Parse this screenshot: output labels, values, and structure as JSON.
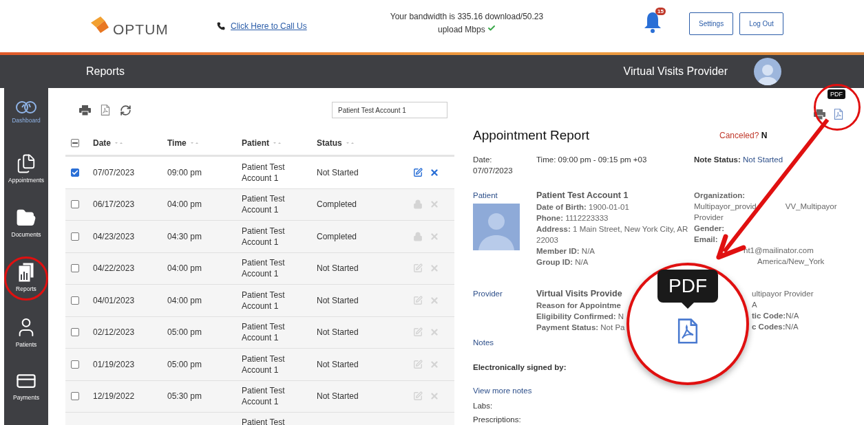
{
  "header": {
    "logo": "OPTUM",
    "call_link": "Click Here to Call Us",
    "bandwidth_line_1": "Your bandwidth is 335.16 download/50.23",
    "bandwidth_line_2": "upload Mbps",
    "bandwidth_ok": true,
    "notification_count": "15",
    "buttons": [
      "Settings",
      "Log Out"
    ]
  },
  "title_bar": {
    "title": "Reports",
    "user": "Virtual Visits Provider"
  },
  "sidebar": {
    "items": [
      {
        "kind": "dashboard",
        "label": "Dashboard",
        "selected": true,
        "circled": false
      },
      {
        "kind": "appointments",
        "label": "Appointments",
        "selected": false,
        "circled": false
      },
      {
        "kind": "documents",
        "label": "Documents",
        "selected": false,
        "circled": false
      },
      {
        "kind": "reports",
        "label": "Reports",
        "selected": false,
        "circled": true
      },
      {
        "kind": "patients",
        "label": "Patients",
        "selected": false,
        "circled": false
      },
      {
        "kind": "payments",
        "label": "Payments",
        "selected": false,
        "circled": false
      }
    ]
  },
  "search": {
    "value": "Patient Test Account 1"
  },
  "table": {
    "select_all_partial": true,
    "columns": [
      "Date",
      "Time",
      "Patient",
      "Status"
    ],
    "rows": [
      {
        "date": "07/07/2023",
        "time": "09:00 pm",
        "patient": "Patient Test Account 1",
        "status": "Not Started",
        "checked": true,
        "locked": false
      },
      {
        "date": "06/17/2023",
        "time": "04:00 pm",
        "patient": "Patient Test Account 1",
        "status": "Completed",
        "checked": false,
        "locked": true
      },
      {
        "date": "04/23/2023",
        "time": "04:30 pm",
        "patient": "Patient Test Account 1",
        "status": "Completed",
        "checked": false,
        "locked": true
      },
      {
        "date": "04/22/2023",
        "time": "04:00 pm",
        "patient": "Patient Test Account 1",
        "status": "Not Started",
        "checked": false,
        "locked": false
      },
      {
        "date": "04/01/2023",
        "time": "04:00 pm",
        "patient": "Patient Test Account 1",
        "status": "Not Started",
        "checked": false,
        "locked": false
      },
      {
        "date": "02/12/2023",
        "time": "05:00 pm",
        "patient": "Patient Test Account 1",
        "status": "Not Started",
        "checked": false,
        "locked": false
      },
      {
        "date": "01/19/2023",
        "time": "05:00 pm",
        "patient": "Patient Test Account 1",
        "status": "Not Started",
        "checked": false,
        "locked": false
      },
      {
        "date": "12/19/2022",
        "time": "05:30 pm",
        "patient": "Patient Test Account 1",
        "status": "Not Started",
        "checked": false,
        "locked": false
      }
    ],
    "partial_row": {
      "patient": "Patient Test"
    }
  },
  "report": {
    "tooltip": "PDF",
    "title": "Appointment Report",
    "canceled_label": "Canceled?",
    "canceled_value": "N",
    "date_label": "Date:",
    "date": "07/07/2023",
    "time": "Time: 09:00 pm - 09:15 pm +03",
    "note_status_label": "Note Status:",
    "note_status": "Not Started",
    "patient": {
      "label": "Patient",
      "name": "Patient Test Account 1",
      "lines": [
        "**Date of Birth:** 1900-01-01",
        "**Phone:** 1112223333",
        "**Address:** 1 Main Street, New York City, AR 22003",
        "**Member ID:** N/A",
        "**Group ID:** N/A"
      ],
      "side_lines": [
        [
          "**Organization:**"
        ],
        [
          "Multipayor_provid",
          "VV_Multipayor"
        ],
        [
          "Provider"
        ],
        [
          "**Gender:**"
        ],
        [
          "**Email:**"
        ],
        [
          "nt1@mailinator.com"
        ],
        [
          "America/New_York"
        ]
      ]
    },
    "provider": {
      "label": "Provider",
      "name": "Virtual Visits Provide",
      "lines": [
        "**Reason for Appointme**",
        "**Eligibility Confirmed:** N",
        "**Payment Status:** Not Pa"
      ],
      "side_lines": [
        "ultipayor Provider",
        "A",
        "**tic Code:**N/A",
        "**c Codes:**N/A"
      ]
    },
    "notes_label": "Notes",
    "signed_label": "Electronically signed by:",
    "view_more": "View more notes",
    "labs_label": "Labs:",
    "prescriptions_label": "Prescriptions:"
  },
  "callout": {
    "tooltip": "PDF"
  }
}
